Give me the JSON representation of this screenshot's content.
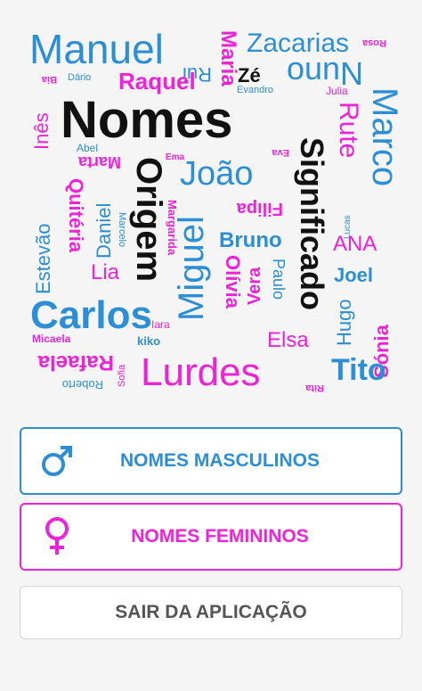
{
  "cloud": [
    {
      "t": "Manuel",
      "c": "#2c8fd6"
    },
    {
      "t": "Rui",
      "c": "#2c8fd6"
    },
    {
      "t": "Maria",
      "c": "#ee22d8"
    },
    {
      "t": "Zacarias",
      "c": "#2c8fd6"
    },
    {
      "t": "Rosa",
      "c": "#ee22d8"
    },
    {
      "t": "Bia",
      "c": "#ee22d8"
    },
    {
      "t": "Dário",
      "c": "#2c8fd6"
    },
    {
      "t": "Raquel",
      "c": "#ee22d8"
    },
    {
      "t": "Zé",
      "c": "#111111"
    },
    {
      "t": "Nuno",
      "c": "#2c8fd6"
    },
    {
      "t": "Evandro",
      "c": "#2c8fd6"
    },
    {
      "t": "Julia",
      "c": "#ee22d8"
    },
    {
      "t": "Inês",
      "c": "#ee22d8"
    },
    {
      "t": "Nomes",
      "c": "#111111"
    },
    {
      "t": "Rute",
      "c": "#ee22d8"
    },
    {
      "t": "Marco",
      "c": "#2c8fd6"
    },
    {
      "t": "Abel",
      "c": "#2c8fd6"
    },
    {
      "t": "Marta",
      "c": "#ee22d8"
    },
    {
      "t": "Ema",
      "c": "#ee22d8"
    },
    {
      "t": "Eva",
      "c": "#ee22d8"
    },
    {
      "t": "Estevão",
      "c": "#2c8fd6"
    },
    {
      "t": "Origem",
      "c": "#111111"
    },
    {
      "t": "João",
      "c": "#2c8fd6"
    },
    {
      "t": "Significado",
      "c": "#111111"
    },
    {
      "t": "Quitéria",
      "c": "#ee22d8"
    },
    {
      "t": "Daniel",
      "c": "#2c8fd6"
    },
    {
      "t": "Marcelo",
      "c": "#2c8fd6"
    },
    {
      "t": "Miguel",
      "c": "#2c8fd6"
    },
    {
      "t": "Filipa",
      "c": "#ee22d8"
    },
    {
      "t": "Lucas",
      "c": "#2c8fd6"
    },
    {
      "t": "Margarida",
      "c": "#ee22d8"
    },
    {
      "t": "Bruno",
      "c": "#2c8fd6"
    },
    {
      "t": "ANA",
      "c": "#ee22d8"
    },
    {
      "t": "Lia",
      "c": "#ee22d8"
    },
    {
      "t": "Olívia",
      "c": "#ee22d8"
    },
    {
      "t": "Vera",
      "c": "#ee22d8"
    },
    {
      "t": "Paulo",
      "c": "#2c8fd6"
    },
    {
      "t": "Joel",
      "c": "#2c8fd6"
    },
    {
      "t": "Hugo",
      "c": "#2c8fd6"
    },
    {
      "t": "Sónia",
      "c": "#ee22d8"
    },
    {
      "t": "Carlos",
      "c": "#2c8fd6"
    },
    {
      "t": "Iara",
      "c": "#ee22d8"
    },
    {
      "t": "Micaela",
      "c": "#ee22d8"
    },
    {
      "t": "kiko",
      "c": "#2c8fd6"
    },
    {
      "t": "Elsa",
      "c": "#ee22d8"
    },
    {
      "t": "Rafaela",
      "c": "#ee22d8"
    },
    {
      "t": "Sofia",
      "c": "#ee22d8"
    },
    {
      "t": "Lurdes",
      "c": "#ee22d8"
    },
    {
      "t": "Tito",
      "c": "#2c8fd6"
    },
    {
      "t": "Roberto",
      "c": "#2c8fd6"
    },
    {
      "t": "Rita",
      "c": "#ee22d8"
    }
  ],
  "buttons": {
    "male": {
      "label": "NOMES MASCULINOS",
      "icon": "male-symbol-icon",
      "color": "#2c8fd6"
    },
    "female": {
      "label": "NOMES FEMININOS",
      "icon": "female-symbol-icon",
      "color": "#ee22d8"
    },
    "exit": {
      "label": "SAIR DA APLICAÇÃO",
      "color": "#555555"
    }
  }
}
